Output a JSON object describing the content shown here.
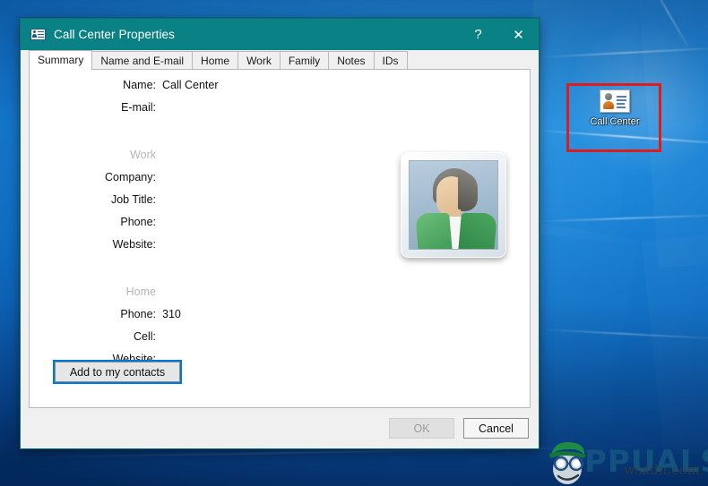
{
  "desktop": {
    "icon": {
      "label": "Call Center",
      "icon_name": "contact-card-icon"
    },
    "annotation": {
      "name": "red-highlight-box",
      "color": "#e01b1b"
    },
    "watermark": {
      "brand": "PPUALS",
      "url": "wsxdn.com"
    }
  },
  "dialog": {
    "title": "Call Center Properties",
    "title_icon": "contact-card-icon",
    "titlebar_color": "#0a8184",
    "help_label": "?",
    "close_label": "✕",
    "tabs": [
      {
        "label": "Summary",
        "active": true
      },
      {
        "label": "Name and E-mail",
        "active": false
      },
      {
        "label": "Home",
        "active": false
      },
      {
        "label": "Work",
        "active": false
      },
      {
        "label": "Family",
        "active": false
      },
      {
        "label": "Notes",
        "active": false
      },
      {
        "label": "IDs",
        "active": false
      }
    ],
    "summary": {
      "top_fields": [
        {
          "label": "Name:",
          "value": "Call Center"
        },
        {
          "label": "E-mail:",
          "value": ""
        }
      ],
      "work_section": "Work",
      "work_fields": [
        {
          "label": "Company:",
          "value": ""
        },
        {
          "label": "Job Title:",
          "value": ""
        },
        {
          "label": "Phone:",
          "value": ""
        },
        {
          "label": "Website:",
          "value": ""
        }
      ],
      "home_section": "Home",
      "home_fields": [
        {
          "label": "Phone:",
          "value": "310"
        },
        {
          "label": "Cell:",
          "value": ""
        },
        {
          "label": "Website:",
          "value": ""
        }
      ],
      "avatar_name": "contact-photo",
      "add_button": "Add to my contacts"
    },
    "footer": {
      "ok": "OK",
      "ok_enabled": false,
      "cancel": "Cancel",
      "cancel_enabled": true
    }
  }
}
